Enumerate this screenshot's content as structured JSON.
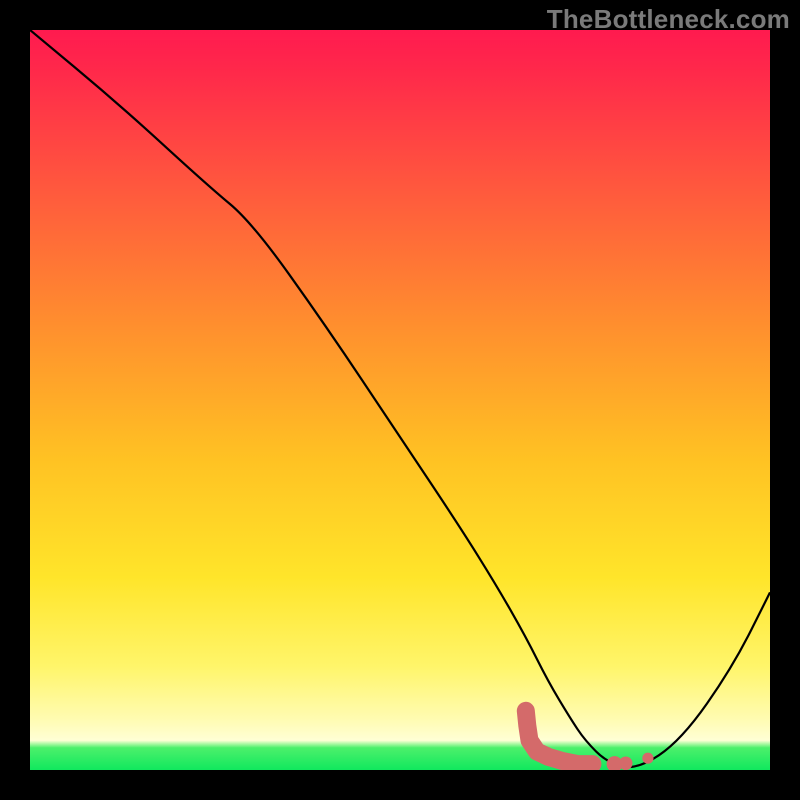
{
  "watermark": "TheBottleneck.com",
  "colors": {
    "frame": "#000000",
    "watermark": "#7a7a7a",
    "curve": "#000000",
    "marker": "#d46a6a",
    "gradient_stops": [
      "#ff1a4f",
      "#ff2a4a",
      "#ff5a3d",
      "#ff8f2e",
      "#ffc223",
      "#ffe52a",
      "#fff56a",
      "#fffbb0",
      "#ffffd5",
      "#4cf06b",
      "#10e85e"
    ]
  },
  "chart_data": {
    "type": "line",
    "title": "",
    "xlabel": "",
    "ylabel": "",
    "xlim": [
      0,
      100
    ],
    "ylim": [
      0,
      100
    ],
    "series": [
      {
        "name": "bottleneck-curve",
        "x": [
          0,
          12,
          24,
          30,
          40,
          50,
          58,
          63,
          67,
          70,
          73,
          75,
          78,
          82,
          88,
          95,
          100
        ],
        "y": [
          100,
          90,
          79,
          74,
          60,
          45,
          33,
          25,
          18,
          12,
          7,
          4,
          1,
          0,
          4,
          14,
          24
        ]
      }
    ],
    "markers": {
      "name": "highlight-segment",
      "points": [
        {
          "x": 67.0,
          "y": 8.0
        },
        {
          "x": 67.2,
          "y": 6.0
        },
        {
          "x": 67.5,
          "y": 4.0
        },
        {
          "x": 68.5,
          "y": 2.5
        },
        {
          "x": 70.0,
          "y": 1.8
        },
        {
          "x": 72.0,
          "y": 1.2
        },
        {
          "x": 74.0,
          "y": 0.8
        },
        {
          "x": 76.0,
          "y": 0.8
        },
        {
          "x": 79.0,
          "y": 0.8
        },
        {
          "x": 80.5,
          "y": 0.9
        },
        {
          "x": 83.5,
          "y": 1.6
        }
      ]
    }
  }
}
